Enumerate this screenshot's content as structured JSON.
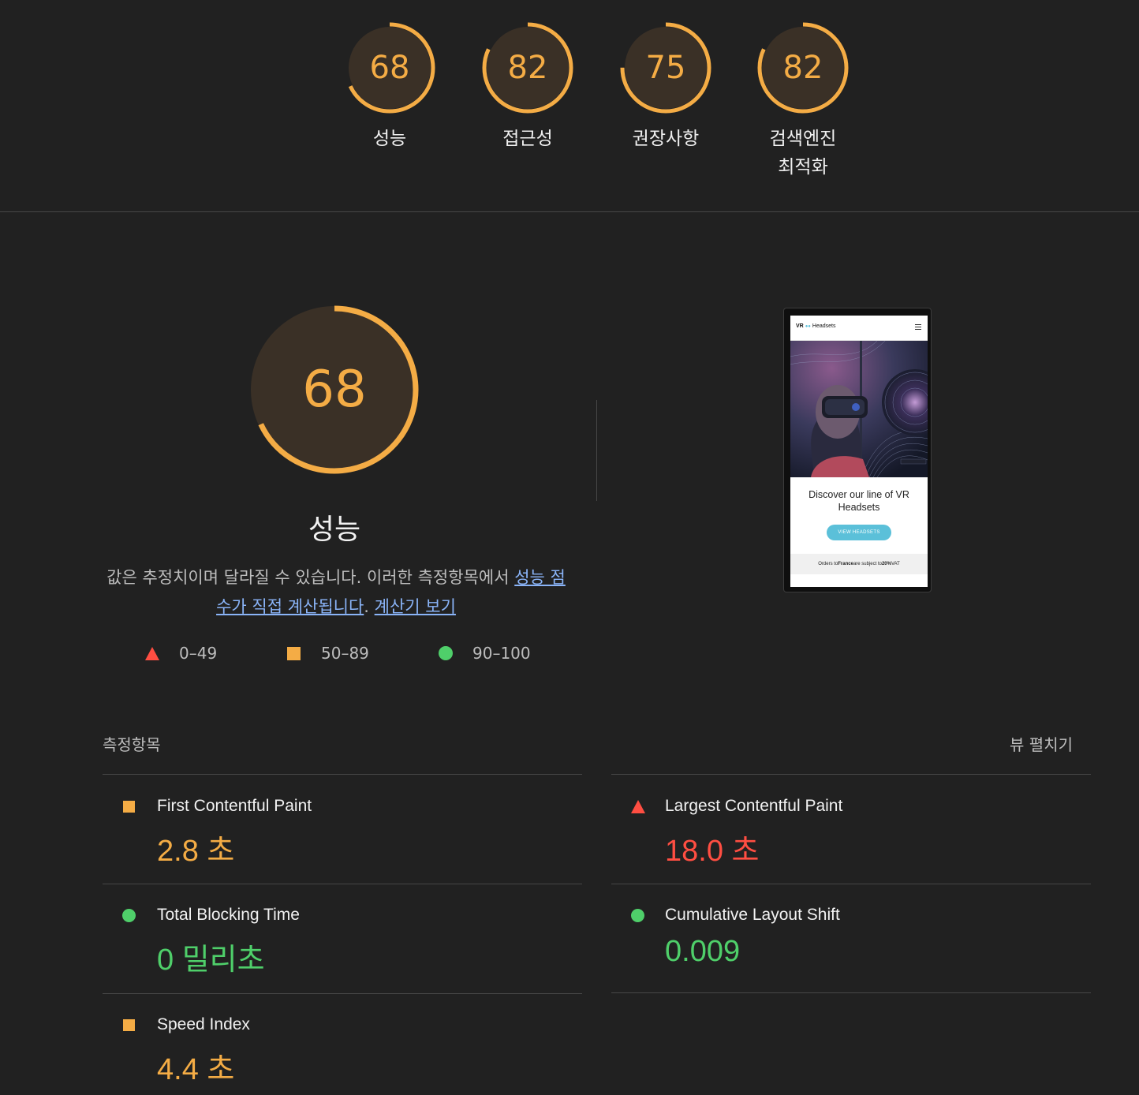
{
  "colors": {
    "average": "#f4ac45",
    "fail": "#ff4e42",
    "pass": "#4fcf6a",
    "link": "#8ab4f8"
  },
  "gauges": [
    {
      "score": "68",
      "label": "성능",
      "progress": 0.68
    },
    {
      "score": "82",
      "label": "접근성",
      "progress": 0.82
    },
    {
      "score": "75",
      "label": "권장사항",
      "progress": 0.75
    },
    {
      "score": "82",
      "label": "검색엔진\n최적화",
      "progress": 0.82
    }
  ],
  "performance": {
    "score": "68",
    "progress": 0.68,
    "title": "성능",
    "desc_prefix": "값은 추정치이며 달라질 수 있습니다. 이러한 측정항목에서 ",
    "desc_link": "성능 점수가 직접 계산됩니다",
    "desc_dot": ". ",
    "calc_link": "계산기 보기"
  },
  "legend": [
    {
      "icon": "triangle",
      "range": "0–49"
    },
    {
      "icon": "square",
      "range": "50–89"
    },
    {
      "icon": "circle",
      "range": "90–100"
    }
  ],
  "screenshot": {
    "logo_prefix": "VR",
    "logo_suffix": "Headsets",
    "hero_text": "Discover our line of VR Headsets",
    "button": "VIEW HEADSETS",
    "footer_pre": "Orders to ",
    "footer_country": "France",
    "footer_mid": " are subject to ",
    "footer_rate": "20%",
    "footer_post": " VAT"
  },
  "metrics": {
    "title": "측정항목",
    "expand": "뷰 펼치기",
    "items": [
      {
        "name": "First Contentful Paint",
        "value": "2.8 초",
        "rating": "average",
        "icon": "square"
      },
      {
        "name": "Largest Contentful Paint",
        "value": "18.0 초",
        "rating": "fail",
        "icon": "triangle"
      },
      {
        "name": "Total Blocking Time",
        "value": "0 밀리초",
        "rating": "pass",
        "icon": "circle"
      },
      {
        "name": "Cumulative Layout Shift",
        "value": "0.009",
        "rating": "pass",
        "icon": "circle"
      },
      {
        "name": "Speed Index",
        "value": "4.4 초",
        "rating": "average",
        "icon": "square"
      }
    ]
  }
}
